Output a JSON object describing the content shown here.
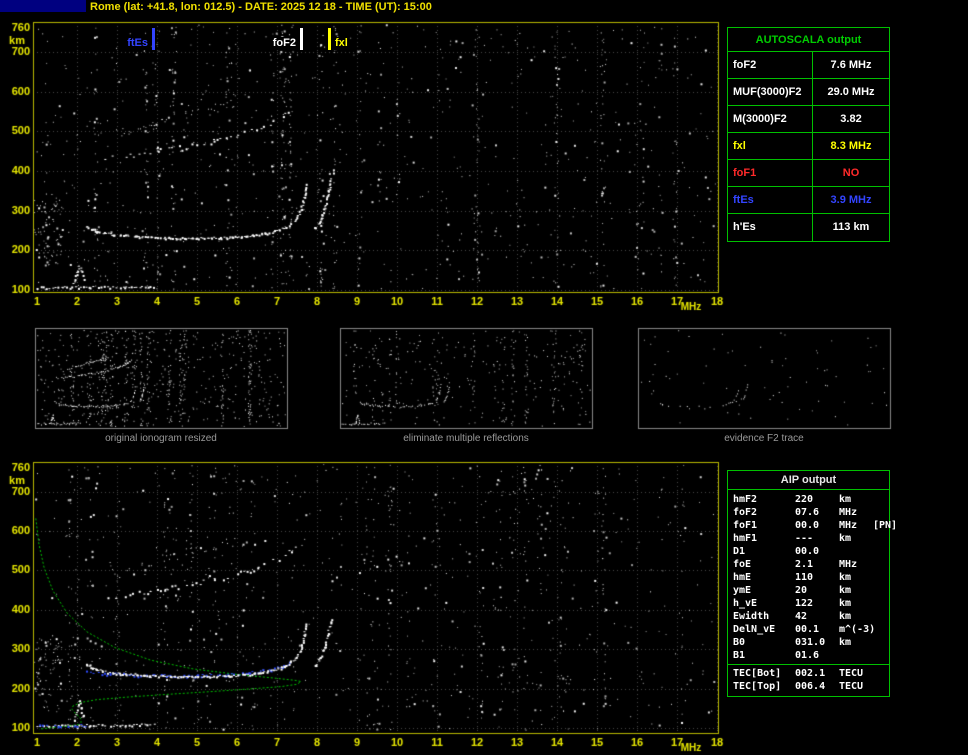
{
  "header": {
    "title": "Rome (lat: +41.8, lon: 012.5) - DATE: 2025 12 18 - TIME (UT): 15:00"
  },
  "autoscala": {
    "title": "AUTOSCALA output",
    "border_color": "#00c000",
    "rows": [
      {
        "label": "foF2",
        "value": "7.6 MHz",
        "color": "#ffffff"
      },
      {
        "label": "MUF(3000)F2",
        "value": "29.0 MHz",
        "color": "#ffffff"
      },
      {
        "label": "M(3000)F2",
        "value": "3.82",
        "color": "#ffffff"
      },
      {
        "label": "fxl",
        "value": "8.3 MHz",
        "color": "#ffff00"
      },
      {
        "label": "foF1",
        "value": "NO",
        "color": "#ff2a2a"
      },
      {
        "label": "ftEs",
        "value": "3.9 MHz",
        "color": "#3344ff"
      },
      {
        "label": "h'Es",
        "value": "113  km",
        "color": "#ffffff"
      }
    ]
  },
  "aip": {
    "title": "AIP output",
    "rows": [
      {
        "label": "hmF2",
        "value": "220",
        "unit": "km",
        "extra": ""
      },
      {
        "label": "foF2",
        "value": "07.6",
        "unit": "MHz",
        "extra": ""
      },
      {
        "label": "foF1",
        "value": "00.0",
        "unit": "MHz",
        "extra": "[PN]"
      },
      {
        "label": "hmF1",
        "value": "---",
        "unit": "km",
        "extra": ""
      },
      {
        "label": "D1",
        "value": "00.0",
        "unit": "",
        "extra": ""
      },
      {
        "label": "foE",
        "value": "2.1",
        "unit": "MHz",
        "extra": ""
      },
      {
        "label": "hmE",
        "value": "110",
        "unit": "km",
        "extra": ""
      },
      {
        "label": "ymE",
        "value": "20",
        "unit": "km",
        "extra": ""
      },
      {
        "label": "h_vE",
        "value": "122",
        "unit": "km",
        "extra": ""
      },
      {
        "label": "Ewidth",
        "value": "42",
        "unit": "km",
        "extra": ""
      },
      {
        "label": "DelN_vE",
        "value": "00.1",
        "unit": "m^(-3)",
        "extra": ""
      },
      {
        "label": "B0",
        "value": "031.0",
        "unit": "km",
        "extra": ""
      },
      {
        "label": "B1",
        "value": "01.6",
        "unit": "",
        "extra": ""
      }
    ],
    "tec_rows": [
      {
        "label": "TEC[Bot]",
        "value": "002.1",
        "unit": "TECU",
        "extra": ""
      },
      {
        "label": "TEC[Top]",
        "value": "006.4",
        "unit": "TECU",
        "extra": ""
      }
    ]
  },
  "thumbnails": [
    {
      "caption": "original ionogram resized"
    },
    {
      "caption": "eliminate multiple reflections"
    },
    {
      "caption": "evidence F2 trace"
    }
  ],
  "chart_data": [
    {
      "id": "top_ionogram",
      "type": "scatter",
      "title": "Ionogram with AUTOSCALA frequency markers",
      "xlabel": "MHz",
      "ylabel": "km",
      "xlim": [
        1,
        18
      ],
      "ylim": [
        100,
        760
      ],
      "xticks": [
        1,
        2,
        3,
        4,
        5,
        6,
        7,
        8,
        9,
        10,
        11,
        12,
        13,
        14,
        15,
        16,
        17,
        18
      ],
      "yticks": [
        760,
        700,
        600,
        500,
        400,
        300,
        200,
        100
      ],
      "grid": true,
      "markers": [
        {
          "label": "ftEs",
          "f": 3.9,
          "color": "#3344ff",
          "label_side": "left"
        },
        {
          "label": "foF2",
          "f": 7.6,
          "color": "#ffffff",
          "label_side": "left"
        },
        {
          "label": "fxl",
          "f": 8.3,
          "color": "#ffff00",
          "label_side": "right"
        }
      ],
      "traces": {
        "es": [
          [
            1.0,
            107
          ],
          [
            1.6,
            107
          ],
          [
            2.3,
            108
          ],
          [
            3.2,
            108
          ],
          [
            3.9,
            110
          ]
        ],
        "cusp": [
          [
            1.88,
            112
          ],
          [
            1.95,
            128
          ],
          [
            2.0,
            148
          ],
          [
            2.05,
            168
          ],
          [
            2.1,
            150
          ],
          [
            2.16,
            124
          ]
        ],
        "f2": [
          [
            2.2,
            262
          ],
          [
            2.5,
            248
          ],
          [
            2.9,
            240
          ],
          [
            3.5,
            235
          ],
          [
            4.2,
            232
          ],
          [
            5.0,
            231
          ],
          [
            5.8,
            233
          ],
          [
            6.4,
            238
          ],
          [
            6.9,
            247
          ],
          [
            7.2,
            258
          ],
          [
            7.45,
            278
          ],
          [
            7.58,
            302
          ],
          [
            7.66,
            332
          ],
          [
            7.72,
            365
          ]
        ],
        "f2x": [
          [
            7.95,
            258
          ],
          [
            8.08,
            280
          ],
          [
            8.18,
            308
          ],
          [
            8.27,
            342
          ],
          [
            8.34,
            380
          ]
        ],
        "hop2": [
          [
            2.7,
            430
          ],
          [
            3.3,
            440
          ],
          [
            4.0,
            451
          ],
          [
            4.7,
            462
          ],
          [
            5.4,
            476
          ],
          [
            6.0,
            492
          ],
          [
            6.5,
            508
          ],
          [
            6.9,
            524
          ],
          [
            7.2,
            540
          ],
          [
            7.45,
            556
          ]
        ],
        "hop2_scatter": [
          [
            3.1,
            498
          ],
          [
            3.7,
            516
          ],
          [
            4.3,
            534
          ],
          [
            4.8,
            548
          ],
          [
            5.3,
            560
          ],
          [
            5.8,
            572
          ]
        ]
      }
    },
    {
      "id": "bottom_ionogram",
      "type": "scatter",
      "title": "Ionogram with restored trace and electron density profile",
      "xlabel": "MHz",
      "ylabel": "km",
      "xlim": [
        1,
        18
      ],
      "ylim": [
        100,
        760
      ],
      "xticks": [
        1,
        2,
        3,
        4,
        5,
        6,
        7,
        8,
        9,
        10,
        11,
        12,
        13,
        14,
        15,
        16,
        17,
        18
      ],
      "yticks": [
        760,
        700,
        600,
        500,
        400,
        300,
        200,
        100
      ],
      "grid": true,
      "profile_color": "#00c000",
      "restored_color": "#2e4bff",
      "profile": [
        [
          0.97,
          632
        ],
        [
          1.05,
          566
        ],
        [
          1.18,
          506
        ],
        [
          1.4,
          448
        ],
        [
          1.75,
          392
        ],
        [
          2.25,
          344
        ],
        [
          2.95,
          304
        ],
        [
          3.85,
          272
        ],
        [
          4.9,
          250
        ],
        [
          6.0,
          236
        ],
        [
          6.9,
          227
        ],
        [
          7.45,
          221
        ],
        [
          7.6,
          218
        ],
        [
          7.5,
          211
        ],
        [
          7.1,
          205
        ],
        [
          6.3,
          199
        ],
        [
          5.3,
          192
        ],
        [
          4.2,
          185
        ],
        [
          3.2,
          178
        ],
        [
          2.5,
          172
        ],
        [
          2.1,
          165
        ],
        [
          1.9,
          156
        ],
        [
          1.87,
          148
        ],
        [
          1.95,
          138
        ],
        [
          2.05,
          129
        ],
        [
          2.1,
          122
        ],
        [
          2.1,
          114
        ],
        [
          2.05,
          109
        ],
        [
          1.8,
          105
        ],
        [
          1.4,
          101
        ],
        [
          1.05,
          97
        ]
      ],
      "restored_trace": [
        [
          2.25,
          244
        ],
        [
          2.8,
          238
        ],
        [
          3.5,
          234
        ],
        [
          4.3,
          233
        ],
        [
          5.0,
          234
        ],
        [
          5.7,
          236
        ],
        [
          6.3,
          241
        ],
        [
          6.8,
          248
        ],
        [
          7.1,
          256
        ],
        [
          7.3,
          266
        ]
      ],
      "restored_es": [
        [
          1.05,
          106
        ],
        [
          1.5,
          106
        ],
        [
          2.0,
          107
        ],
        [
          2.35,
          107
        ]
      ]
    },
    {
      "id": "processing_thumbnails",
      "type": "scatter",
      "panels": [
        {
          "id": "original",
          "traces": [
            "es",
            "cusp",
            "f2",
            "f2x",
            "hop2",
            "hop2_scatter"
          ],
          "noise": 800,
          "prob": 0.85,
          "step": 2
        },
        {
          "id": "filtered",
          "traces": [
            "es",
            "cusp",
            "f2",
            "f2x"
          ],
          "noise": 400,
          "prob": 0.8,
          "step": 2
        },
        {
          "id": "f2_evidence",
          "traces": [
            "f2",
            "f2x"
          ],
          "noise": 80,
          "prob": 0.35,
          "step": 4
        }
      ]
    }
  ]
}
